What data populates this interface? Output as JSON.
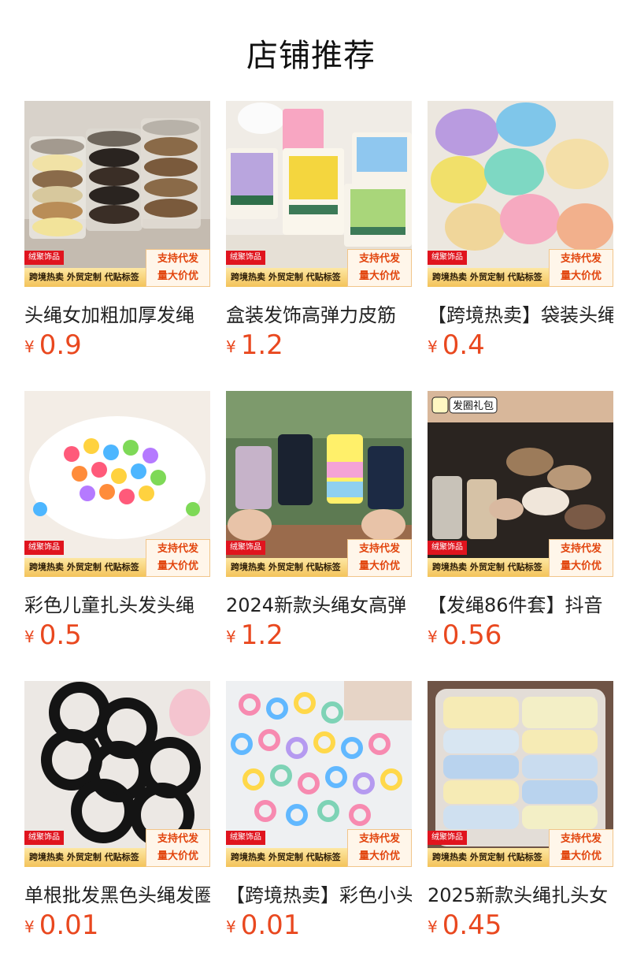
{
  "page": {
    "title": "店铺推荐"
  },
  "common": {
    "brand_tag": "绒聚饰品",
    "promo_line1": "支持代发",
    "promo_line2": "量大价优",
    "bar_text": "跨境热卖 外贸定制 代贴标签",
    "currency": "¥"
  },
  "products": [
    {
      "name": "头绳女加粗加厚发绳",
      "price": "0.9",
      "photo_icon": "hair-tie-jars"
    },
    {
      "name": "盒装发饰高弹力皮筋",
      "price": "1.2",
      "photo_icon": "hair-band-boxes"
    },
    {
      "name": "【跨境热卖】袋装头绳",
      "price": "0.4",
      "photo_icon": "hair-tie-bags"
    },
    {
      "name": "彩色儿童扎头发头绳",
      "price": "0.5",
      "photo_icon": "colorful-kids-ties"
    },
    {
      "name": "2024新款头绳女高弹",
      "price": "1.2",
      "photo_icon": "hair-tie-tubes"
    },
    {
      "name": "【发绳86件套】抖音",
      "price": "0.56",
      "photo_icon": "hair-tie-gift-set",
      "photo_text": "发圈礼包"
    },
    {
      "name": "单根批发黑色头绳发圈",
      "price": "0.01",
      "photo_icon": "black-hair-ties"
    },
    {
      "name": "【跨境热卖】彩色小头绳",
      "price": "0.01",
      "photo_icon": "mini-colorful-ties"
    },
    {
      "name": "2025新款头绳扎头女",
      "price": "0.45",
      "photo_icon": "pastel-hair-ties-box"
    }
  ]
}
